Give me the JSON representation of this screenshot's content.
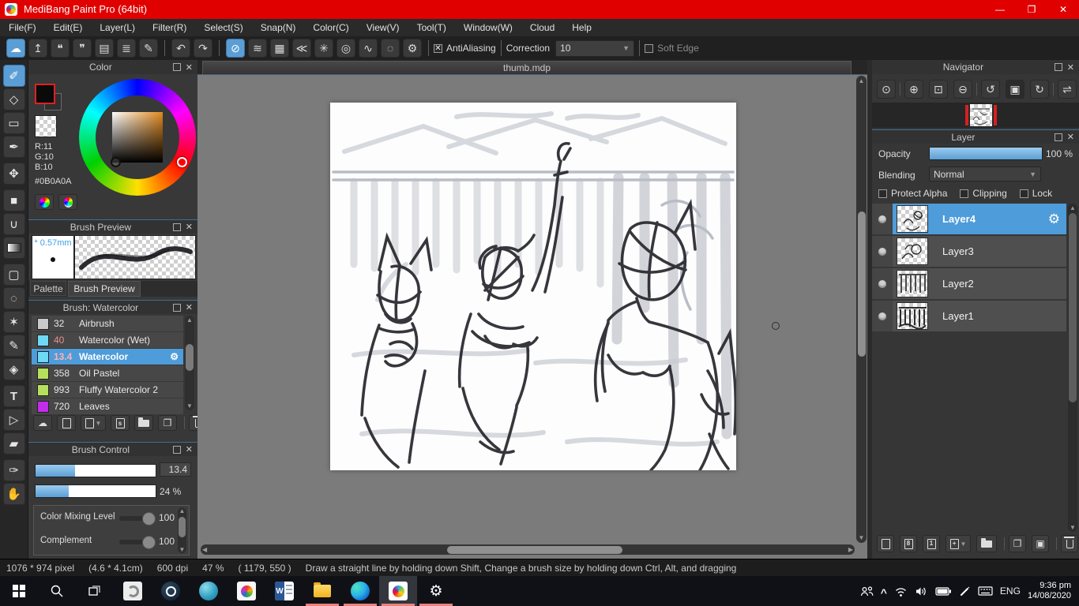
{
  "colors": {
    "titlebar_red": "#e10000",
    "accent_blue": "#4e9cd9",
    "run_underline": "#e8837e",
    "current_color": "#0B0A0A"
  },
  "window": {
    "title": "MediBang Paint Pro (64bit)",
    "minimize": "—",
    "restore": "❐",
    "close": "✕"
  },
  "menu": {
    "items": [
      "File(F)",
      "Edit(E)",
      "Layer(L)",
      "Filter(R)",
      "Select(S)",
      "Snap(N)",
      "Color(C)",
      "View(V)",
      "Tool(T)",
      "Window(W)",
      "Cloud",
      "Help"
    ]
  },
  "toolbar": {
    "antialiasing": "AntiAliasing",
    "aa_check": "✕",
    "correction": "Correction",
    "correction_value": "10",
    "soft_edge": "Soft Edge",
    "icons": {
      "cloud": "☁",
      "upload": "↥",
      "chat": "❝",
      "comment": "❞",
      "document": "▤",
      "history": "≣",
      "compose": "✎",
      "undo": "↶",
      "redo": "↷",
      "no_snap": "⊘",
      "parallel": "≋",
      "grid": "▦",
      "vanishing": "≪",
      "radial": "✳",
      "concentric": "◎",
      "curve": "∿",
      "ellipse": "◌",
      "snap_settings": "⚙",
      "dd_arrow": "▼"
    }
  },
  "tools": {
    "brush": "✐",
    "eraser": "◇",
    "shape": "▭",
    "control_pen": "✒",
    "move": "✥",
    "fill_rect": "■",
    "bucket": "∪",
    "marquee": "▢",
    "lasso": "◌",
    "wand": "✶",
    "select_pen": "✎",
    "select_eraser": "◈",
    "text": "T",
    "shape_select": "▷",
    "eraser2": "▰",
    "eyedropper": "✑",
    "hand": "✋"
  },
  "color_panel": {
    "title": "Color",
    "r": "R:11",
    "g": "G:10",
    "b": "B:10",
    "hex": "#0B0A0A"
  },
  "brush_preview": {
    "title": "Brush Preview",
    "size": "* 0.57mm"
  },
  "panel_tabs": {
    "palette": "Palette",
    "brush_preview": "Brush Preview"
  },
  "brush_panel": {
    "title": "Brush: Watercolor",
    "gear": "⚙",
    "brushes": [
      {
        "size": "32",
        "name": "Airbrush",
        "swatch": "background:#c9c9c9"
      },
      {
        "size": "40",
        "name": "Watercolor (Wet)",
        "swatch": "background:#6fd8f5"
      },
      {
        "size": "13.4",
        "name": "Watercolor",
        "swatch": "background:#6fd8f5"
      },
      {
        "size": "358",
        "name": "Oil Pastel",
        "swatch": "background:#b6e05b"
      },
      {
        "size": "993",
        "name": "Fluffy Watercolor 2",
        "swatch": "background:#b6e05b"
      },
      {
        "size": "720",
        "name": "Leaves",
        "swatch": "background:#c32ce8"
      }
    ]
  },
  "brush_control": {
    "title": "Brush Control",
    "size_value": "13.4",
    "opacity_value": "24 %",
    "rows": [
      {
        "label": "Color Mixing Level",
        "value": "100"
      },
      {
        "label": "Complement",
        "value": "100"
      }
    ]
  },
  "canvas": {
    "tab": "thumb.mdp"
  },
  "navigator": {
    "title": "Navigator",
    "icons": {
      "pixel": "⊙",
      "zoom_in": "⊕",
      "fit": "⊡",
      "zoom_out": "⊖",
      "rot_ccw": "↺",
      "reset": "▣",
      "rot_cw": "↻",
      "flip": "⇌"
    }
  },
  "layer_panel": {
    "title": "Layer",
    "opacity_label": "Opacity",
    "opacity_value": "100 %",
    "blending_label": "Blending",
    "blending_value": "Normal",
    "protect_alpha": "Protect Alpha",
    "clipping": "Clipping",
    "lock": "Lock",
    "gear": "⚙",
    "dup_icon": "❐",
    "transfer_icon": "▣",
    "layers": [
      {
        "name": "Layer4"
      },
      {
        "name": "Layer3"
      },
      {
        "name": "Layer2"
      },
      {
        "name": "Layer1"
      }
    ]
  },
  "status": {
    "size": "1076 * 974 pixel",
    "cm": "(4.6 * 4.1cm)",
    "dpi": "600 dpi",
    "zoom": "47 %",
    "coords": "( 1179, 550 )",
    "hint": "Draw a straight line by holding down Shift, Change a brush size by holding down Ctrl, Alt, and dragging"
  },
  "taskbar": {
    "lang": "ENG",
    "time": "9:36 pm",
    "date": "14/08/2020"
  }
}
